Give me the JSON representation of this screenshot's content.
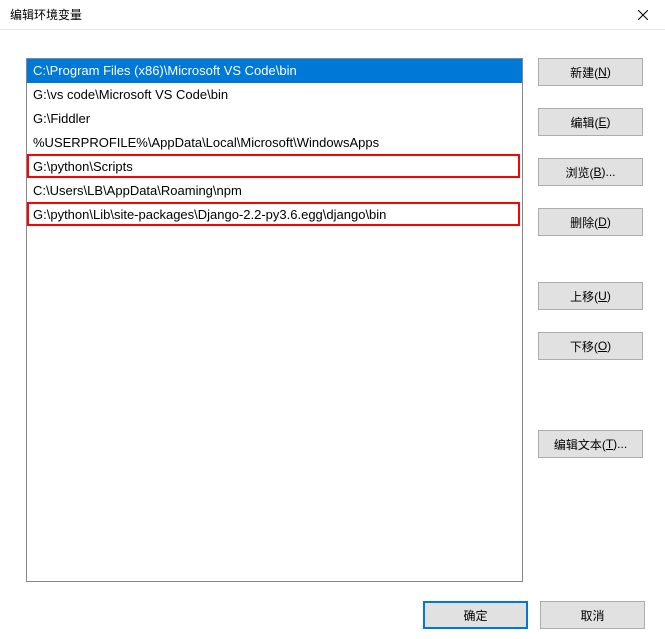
{
  "window": {
    "title": "编辑环境变量"
  },
  "list": {
    "items": [
      "C:\\Program Files (x86)\\Microsoft VS Code\\bin",
      "G:\\vs code\\Microsoft VS Code\\bin",
      "G:\\Fiddler",
      "%USERPROFILE%\\AppData\\Local\\Microsoft\\WindowsApps",
      "G:\\python\\Scripts",
      "C:\\Users\\LB\\AppData\\Roaming\\npm",
      "G:\\python\\Lib\\site-packages\\Django-2.2-py3.6.egg\\django\\bin"
    ],
    "selected_index": 0,
    "highlighted_indices": [
      4,
      6
    ]
  },
  "buttons": {
    "new": {
      "pre": "新建(",
      "u": "N",
      "post": ")"
    },
    "edit": {
      "pre": "编辑(",
      "u": "E",
      "post": ")"
    },
    "browse": {
      "pre": "浏览(",
      "u": "B",
      "post": ")..."
    },
    "delete": {
      "pre": "删除(",
      "u": "D",
      "post": ")"
    },
    "move_up": {
      "pre": "上移(",
      "u": "U",
      "post": ")"
    },
    "move_down": {
      "pre": "下移(",
      "u": "O",
      "post": ")"
    },
    "edit_text": {
      "pre": "编辑文本(",
      "u": "T",
      "post": ")..."
    },
    "ok": {
      "pre": "确定",
      "u": "",
      "post": ""
    },
    "cancel": {
      "pre": "取消",
      "u": "",
      "post": ""
    }
  }
}
